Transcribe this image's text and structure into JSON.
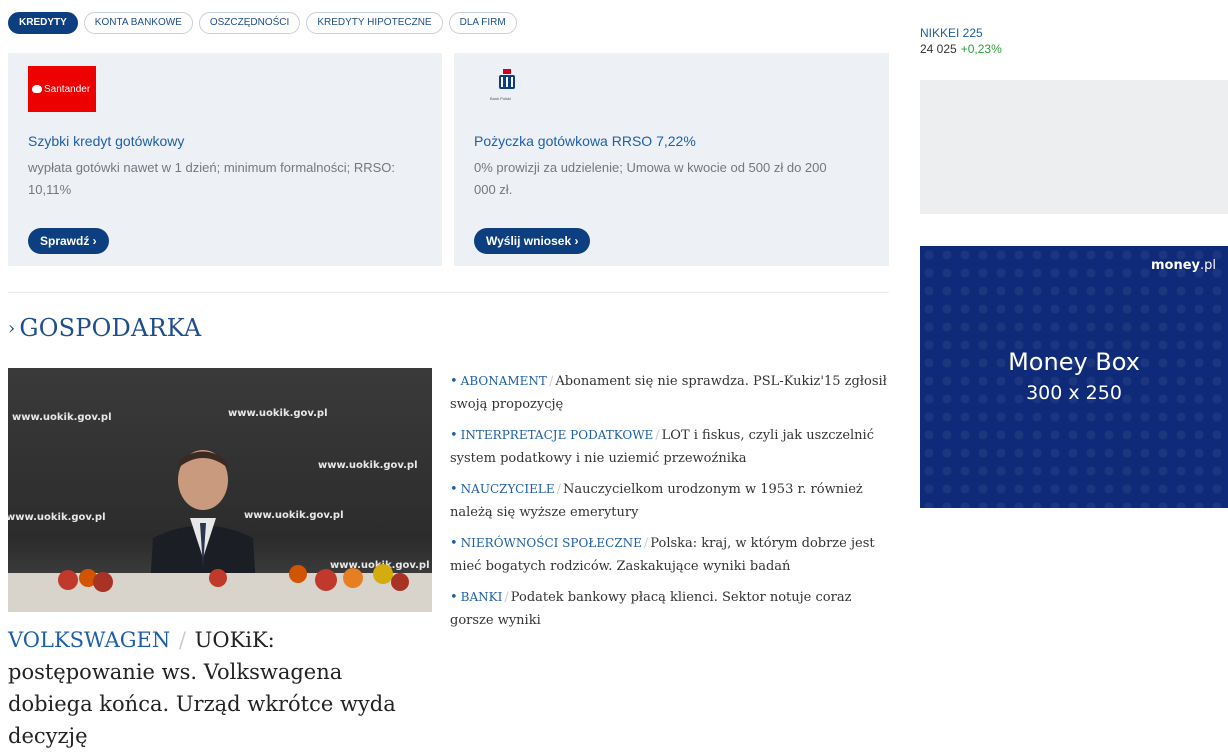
{
  "tabs": [
    {
      "label": "KREDYTY",
      "active": true
    },
    {
      "label": "KONTA BANKOWE",
      "active": false
    },
    {
      "label": "OSZCZĘDNOŚCI",
      "active": false
    },
    {
      "label": "KREDYTY HIPOTECZNE",
      "active": false
    },
    {
      "label": "DLA FIRM",
      "active": false
    }
  ],
  "offers": [
    {
      "logo_text": "Santander",
      "title": "Szybki kredyt gotówkowy",
      "description": "wypłata gotówki nawet w 1 dzień; minimum formalności; RRSO: 10,11%",
      "button": "Sprawdź ›"
    },
    {
      "logo_text": "Bank Polski",
      "title": "Pożyczka gotówkowa RRSO 7,22%",
      "description": "0% prowizji za udzielenie; Umowa w kwocie od 500 zł do 200 000 zł.",
      "button": "Wyślij wniosek ›"
    }
  ],
  "section": {
    "chevron": "›",
    "title": "GOSPODARKA"
  },
  "photo": {
    "watermark": "www.uokik.gov.pl"
  },
  "lead": {
    "category": "VOLKSWAGEN",
    "separator": "/",
    "headline": "UOKiK: postępowanie ws. Volkswagena dobiega końca. Urząd wkrótce wyda decyzję"
  },
  "news": [
    {
      "category": "ABONAMENT",
      "text": "Abonament się nie sprawdza. PSL-Kukiz'15 zgłosił swoją propozycję"
    },
    {
      "category": "INTERPRETACJE PODATKOWE",
      "text": "LOT i fiskus, czyli jak uszczelnić system podatkowy i nie uziemić przewoźnika"
    },
    {
      "category": "NAUCZYCIELE",
      "text": "Nauczycielkom urodzonym w 1953 r. również należą się wyższe emerytury"
    },
    {
      "category": "NIERÓWNOŚCI SPOŁECZNE",
      "text": "Polska: kraj, w którym dobrze jest mieć bogatych rodziców. Zaskakujące wyniki badań"
    },
    {
      "category": "BANKI",
      "text": "Podatek bankowy płacą klienci. Sektor notuje coraz gorsze wyniki"
    }
  ],
  "ticker": {
    "name": "NIKKEI 225",
    "value": "24 025",
    "change": "+0,23%",
    "change_color": "#2e9e3a"
  },
  "ad": {
    "brand_bold": "money",
    "brand_light": ".pl",
    "title": "Money Box",
    "size": "300 x 250",
    "background": "#0e2a78"
  },
  "colors": {
    "accent": "#0d3f80",
    "link": "#1f5fa8",
    "card_bg": "#edf1f6"
  }
}
